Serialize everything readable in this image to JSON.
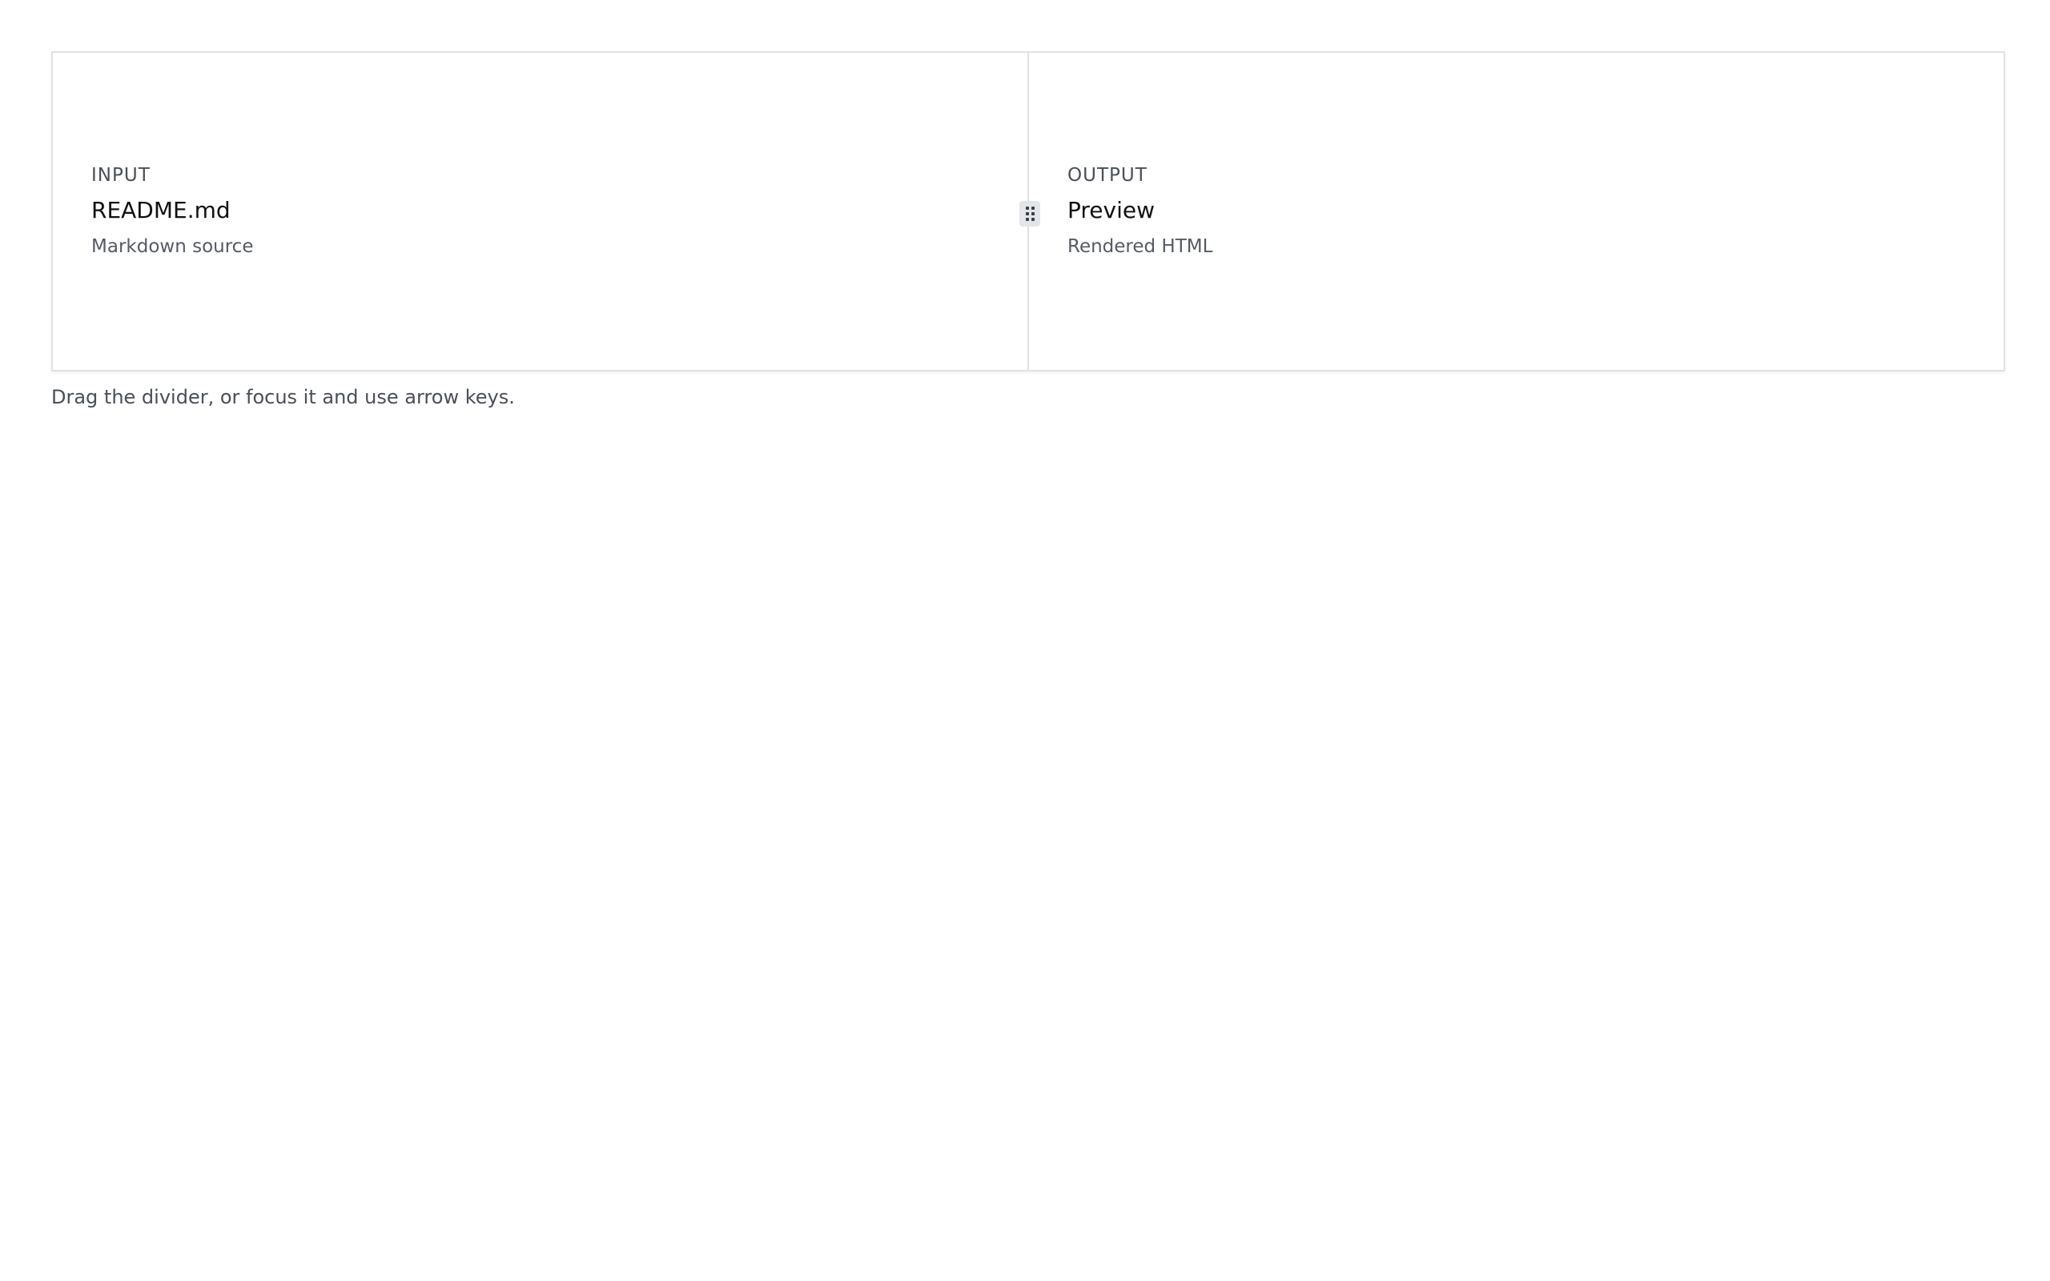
{
  "split": {
    "input": {
      "eyebrow": "INPUT",
      "title": "README.md",
      "subtitle": "Markdown source"
    },
    "output": {
      "eyebrow": "OUTPUT",
      "title": "Preview",
      "subtitle": "Rendered HTML"
    },
    "divider": {
      "icon": "grip-vertical-icon"
    }
  },
  "hint": "Drag the divider, or focus it and use arrow keys.",
  "colors": {
    "border": "#e2e2e2",
    "handle_bg": "#e3e5e8",
    "text_muted": "#4a4f57",
    "text_strong": "#111111"
  }
}
